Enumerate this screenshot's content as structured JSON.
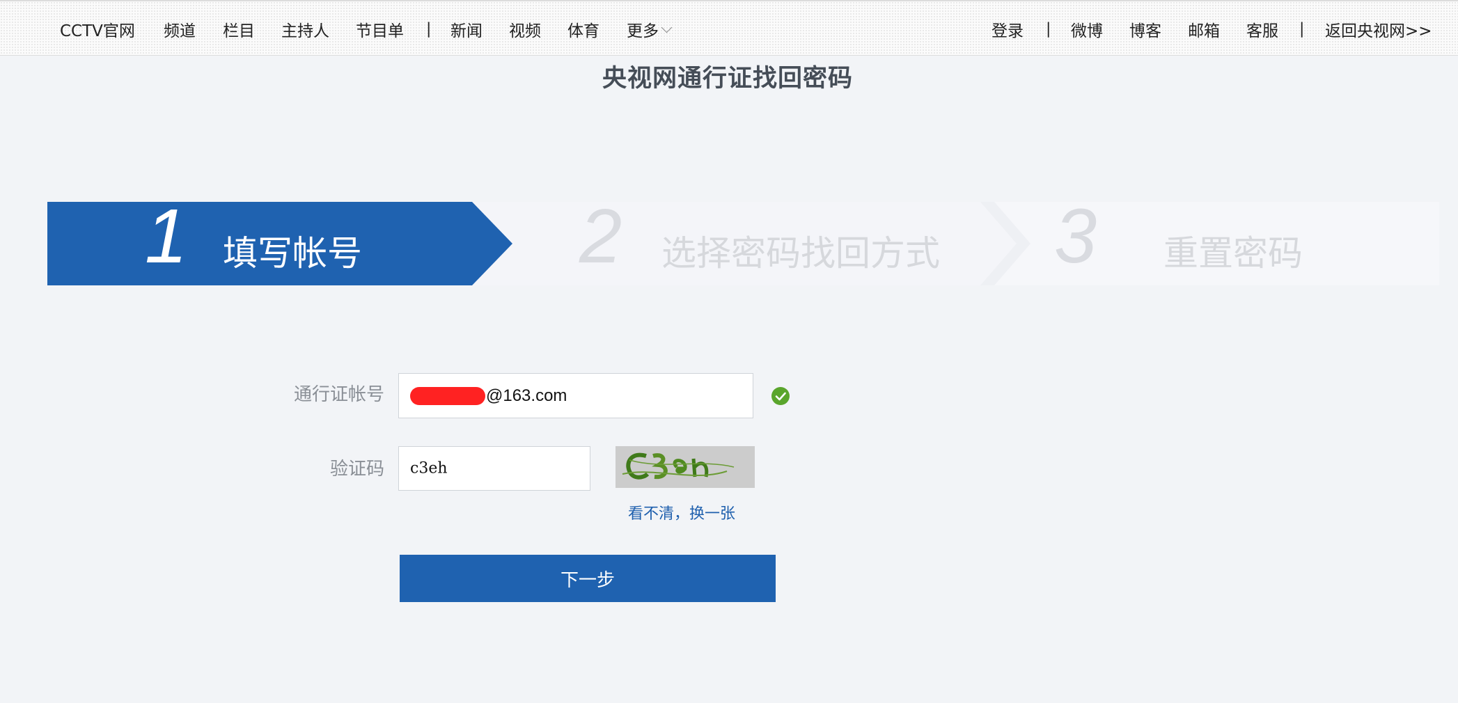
{
  "nav": {
    "left": [
      "CCTV官网",
      "频道",
      "栏目",
      "主持人",
      "节目单",
      "新闻",
      "视频",
      "体育",
      "更多"
    ],
    "separator": "|",
    "right": [
      "登录",
      "微博",
      "博客",
      "邮箱",
      "客服",
      "返回央视网>>"
    ]
  },
  "page_title": "央视网通行证找回密码",
  "steps": [
    {
      "number": "1",
      "label": "填写帐号",
      "state": "active"
    },
    {
      "number": "2",
      "label": "选择密码找回方式",
      "state": "inactive"
    },
    {
      "number": "3",
      "label": "重置密码",
      "state": "inactive"
    }
  ],
  "colors": {
    "accent": "#1f62b0",
    "step_inactive_bg": "#f6f7fa",
    "step_inactive_text": "#d6d8dc",
    "success": "#5aa52c",
    "link": "#1e5fad"
  },
  "form": {
    "account_label": "通行证帐号",
    "account_value": "@163.com",
    "account_status_icon": "check-circle-icon",
    "captcha_label": "验证码",
    "captcha_value": "c3eh",
    "captcha_refresh": "看不清，换一张",
    "next_button": "下一步"
  }
}
